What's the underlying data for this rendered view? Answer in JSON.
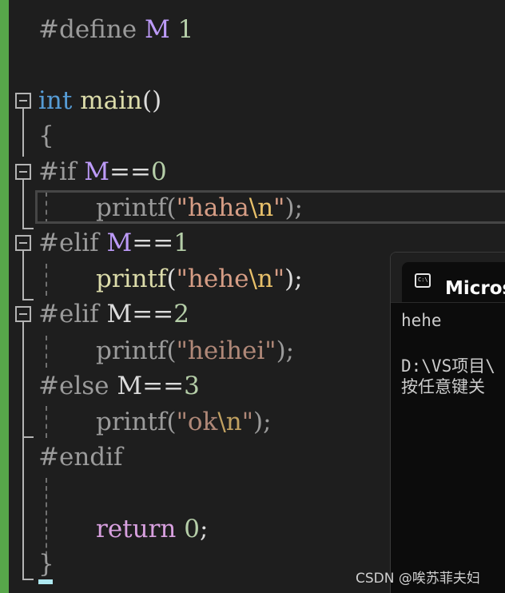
{
  "editor": {
    "lines": {
      "define": {
        "directive": "#define",
        "macro": "M",
        "value": "1"
      },
      "main": {
        "type": "int",
        "name": "main",
        "parens": "()"
      },
      "open_brace": "{",
      "if": {
        "directive": "#if",
        "macro": "M",
        "op": "==",
        "value": "0"
      },
      "print_haha": {
        "func": "printf",
        "open": "(",
        "str_open": "\"haha",
        "esc": "\\n",
        "str_close": "\"",
        "close": ");"
      },
      "elif1": {
        "directive": "#elif",
        "macro": "M",
        "op": "==",
        "value": "1"
      },
      "print_hehe": {
        "func": "printf",
        "open": "(",
        "str_open": "\"hehe",
        "esc": "\\n",
        "str_close": "\"",
        "close": ");"
      },
      "elif2": {
        "directive": "#elif",
        "macro": "M",
        "op": "==",
        "value": "2"
      },
      "print_heihei": {
        "func": "printf",
        "open": "(",
        "str": "\"heihei\"",
        "close": ");"
      },
      "else": {
        "directive": "#else",
        "macro": "M",
        "op": "==",
        "value": "3"
      },
      "print_ok": {
        "func": "printf",
        "open": "(",
        "str_open": "\"ok",
        "esc": "\\n",
        "str_close": "\"",
        "close": ");"
      },
      "endif": {
        "directive": "#endif"
      },
      "return": {
        "keyword": "return",
        "value": "0",
        "semi": ";"
      },
      "close_brace": "}"
    }
  },
  "console": {
    "title": "Microsoft Visual Studio 调试控制台",
    "output": [
      "hehe",
      "D:\\VS项目\\",
      "按任意键关"
    ]
  },
  "watermark": "CSDN @唉苏菲夫妇",
  "colors": {
    "background": "#1e1e1e",
    "change_bar": "#57a64a",
    "keyword": "#569cd6",
    "function": "#dcdcaa",
    "string": "#d69d85",
    "macro": "#bd9bf9",
    "number": "#b5cea8"
  }
}
